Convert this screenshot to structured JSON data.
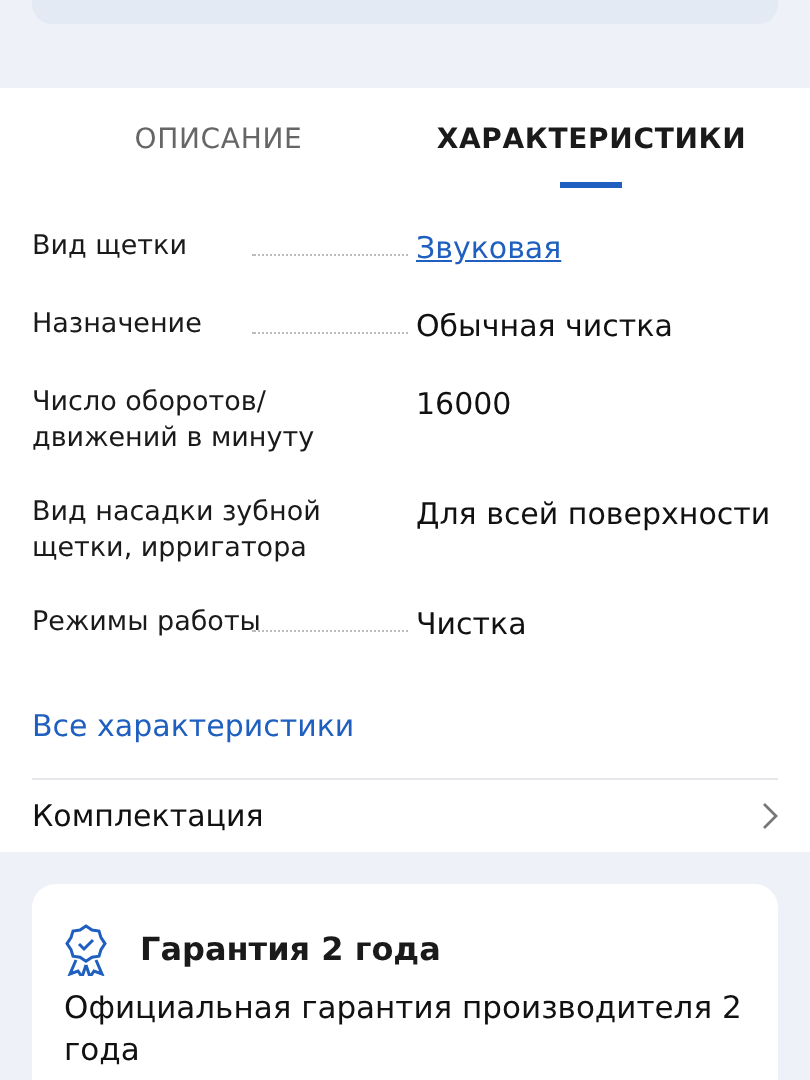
{
  "tabs": [
    {
      "label": "ОПИСАНИЕ",
      "selected": false
    },
    {
      "label": "ХАРАКТЕРИСТИКИ",
      "selected": true
    }
  ],
  "specs": [
    {
      "label": "Вид щетки",
      "value": "Звуковая",
      "kind": "link"
    },
    {
      "label": "Назначение",
      "value": "Обычная чистка",
      "kind": "text"
    },
    {
      "label": "Число оборотов/ движений в минуту",
      "value": "16000",
      "kind": "text"
    },
    {
      "label": "Вид насадки зубной щетки, ирригатора",
      "value": "Для всей поверхности",
      "kind": "text"
    },
    {
      "label": "Режимы работы",
      "value": "Чистка",
      "kind": "text"
    }
  ],
  "all_specs_link": "Все характеристики",
  "kit_row": "Комплектация",
  "warranty": {
    "title": "Гарантия 2 года",
    "text": "Официальная гарантия производителя 2 года"
  }
}
